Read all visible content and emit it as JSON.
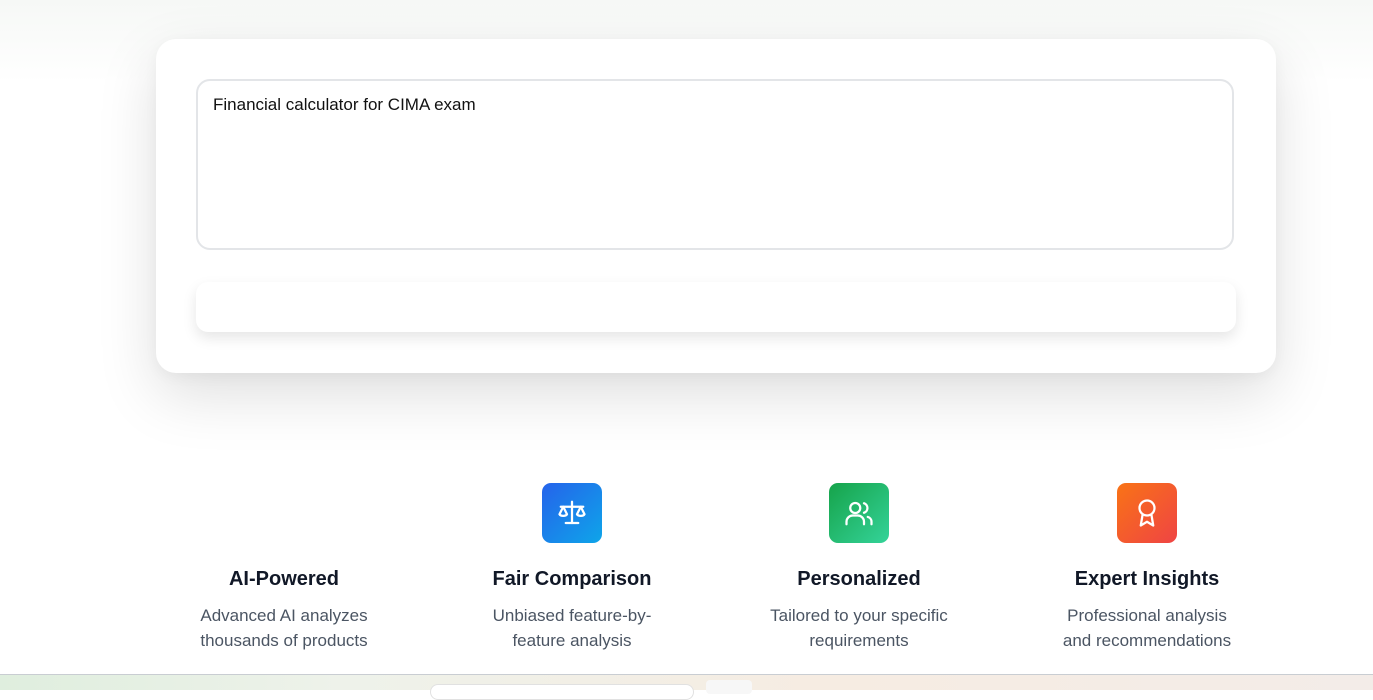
{
  "search": {
    "query_value": "Financial calculator for CIMA exam",
    "submit_label": ""
  },
  "features": [
    {
      "icon": "",
      "title": "AI-Powered",
      "description": "Advanced AI analyzes thousands of products"
    },
    {
      "icon": "scale-icon",
      "title": "Fair Comparison",
      "description": "Unbiased feature-by-feature analysis",
      "color": "#2563eb"
    },
    {
      "icon": "users-icon",
      "title": "Personalized",
      "description": "Tailored to your specific requirements",
      "color": "#16a34a"
    },
    {
      "icon": "award-icon",
      "title": "Expert Insights",
      "description": "Professional analysis and recommendations",
      "color": "#f97316"
    }
  ]
}
